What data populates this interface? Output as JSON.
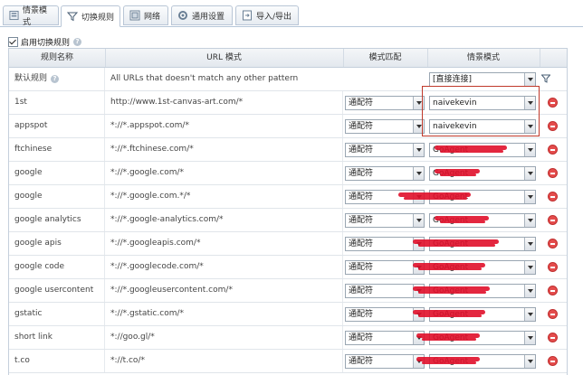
{
  "tabs": [
    {
      "label": "情景模式",
      "icon": "profile-icon"
    },
    {
      "label": "切换规则",
      "icon": "filter-icon"
    },
    {
      "label": "网络",
      "icon": "network-icon"
    },
    {
      "label": "通用设置",
      "icon": "settings-icon"
    },
    {
      "label": "导入/导出",
      "icon": "import-export-icon"
    }
  ],
  "enable": {
    "label": "启用切换规则",
    "checked": true
  },
  "columns": {
    "name": "规则名称",
    "url": "URL 模式",
    "match": "模式匹配",
    "profile": "情景模式"
  },
  "default_rule": {
    "name": "默认规则",
    "url": "All URLs that doesn't match any other pattern",
    "profile": "[直接连接]"
  },
  "rules": [
    {
      "name": "1st",
      "url": "http://www.1st-canvas-art.com/*",
      "match": "通配符",
      "profile": "naivekevin"
    },
    {
      "name": "appspot",
      "url": "*://*.appspot.com/*",
      "match": "通配符",
      "profile": "naivekevin"
    },
    {
      "name": "ftchinese",
      "url": "*://*.ftchinese.com/*",
      "match": "通配符",
      "profile": "GoAgent"
    },
    {
      "name": "google",
      "url": "*://*.google.com/*",
      "match": "通配符",
      "profile": "GoAgent"
    },
    {
      "name": "google",
      "url": "*://*.google.com.*/*",
      "match": "通配符",
      "profile": "GoAgent"
    },
    {
      "name": "google analytics",
      "url": "*://*.google-analytics.com/*",
      "match": "通配符",
      "profile": "GoAgent"
    },
    {
      "name": "google apis",
      "url": "*://*.googleapis.com/*",
      "match": "通配符",
      "profile": "GoAgent"
    },
    {
      "name": "google code",
      "url": "*://*.googlecode.com/*",
      "match": "通配符",
      "profile": "GoAgent"
    },
    {
      "name": "google usercontent",
      "url": "*://*.googleusercontent.com/*",
      "match": "通配符",
      "profile": "GoAgent"
    },
    {
      "name": "gstatic",
      "url": "*://*.gstatic.com/*",
      "match": "通配符",
      "profile": "GoAgent"
    },
    {
      "name": "short link",
      "url": "*://goo.gl/*",
      "match": "通配符",
      "profile": "GoAgent"
    },
    {
      "name": "t.co",
      "url": "*://t.co/*",
      "match": "通配符",
      "profile": "GoAgent"
    }
  ],
  "accent": "#c0392b"
}
